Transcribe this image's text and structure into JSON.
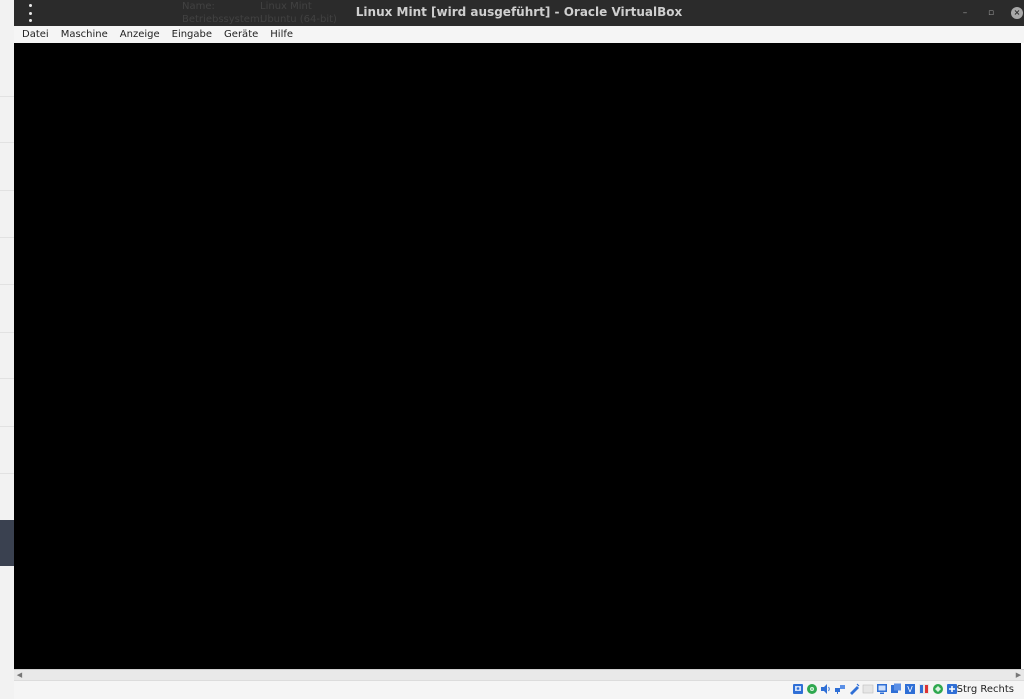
{
  "background_window": {
    "rows": [
      {
        "label": "Name:",
        "value": "Linux Mint"
      },
      {
        "label": "Betriebssystem:",
        "value": "Ubuntu (64-bit)"
      }
    ]
  },
  "window": {
    "title": "Linux Mint [wird ausgeführt] - Oracle VirtualBox",
    "minimize_glyph": "–",
    "maximize_glyph": "▫",
    "close_glyph": "×"
  },
  "menubar": {
    "items": [
      "Datei",
      "Maschine",
      "Anzeige",
      "Eingabe",
      "Geräte",
      "Hilfe"
    ]
  },
  "vm_screen": {
    "color": "#000000"
  },
  "scrollbar": {
    "left_arrow": "◀",
    "right_arrow": "▶"
  },
  "statusbar": {
    "icons": [
      "hard-disk-icon",
      "optical-drive-icon",
      "audio-icon",
      "network-icon",
      "usb-icon",
      "shared-folders-icon",
      "display-icon",
      "video-capture-icon",
      "virtualization-icon",
      "guest-additions-icon",
      "mouse-integration-icon",
      "keyboard-capture-icon"
    ],
    "host_key_label": "Strg Rechts"
  },
  "colors": {
    "titlebar": "#2b2b2b",
    "menubar": "#f5f5f5",
    "vm_screen": "#000000",
    "icon_blue": "#2f6fd6",
    "icon_green": "#2fa84f"
  }
}
